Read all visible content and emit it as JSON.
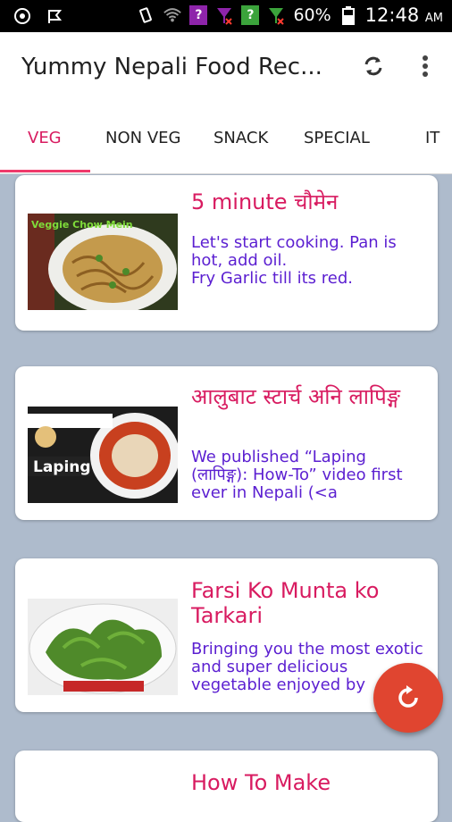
{
  "status_bar": {
    "box1": "?",
    "box2": "?",
    "battery": "60%",
    "time": "12:48",
    "ampm": "AM"
  },
  "appbar": {
    "title": "Yummy Nepali Food Rec...",
    "refresh_icon": "refresh-icon",
    "more_icon": "more-vert-icon"
  },
  "tabs": [
    "VEG",
    "NON VEG",
    "SNACK",
    "SPECIAL",
    "IT"
  ],
  "cards": [
    {
      "title": "5 minute चौमेन",
      "description": "Let's start cooking. Pan is hot, add oil.\nFry Garlic till its red.",
      "thumb_text": "Veggie Chow Mein"
    },
    {
      "title": "आलुबाट स्टार्च अनि लापिङ्ग",
      "description": " We published “Laping (लापिङ्ग): How-To” video first ever in Nepali (<a",
      "thumb_text": "Laping"
    },
    {
      "title": "Farsi Ko Munta ko Tarkari",
      "description": "Bringing you the most exotic and super delicious vegetable enjoyed by",
      "thumb_text": ""
    },
    {
      "title": "How To Make",
      "description": "",
      "thumb_text": ""
    }
  ],
  "colors": {
    "accent": "#d81b60",
    "desc": "#5b1fd1",
    "fab": "#e04530",
    "background": "#aebbcc"
  }
}
